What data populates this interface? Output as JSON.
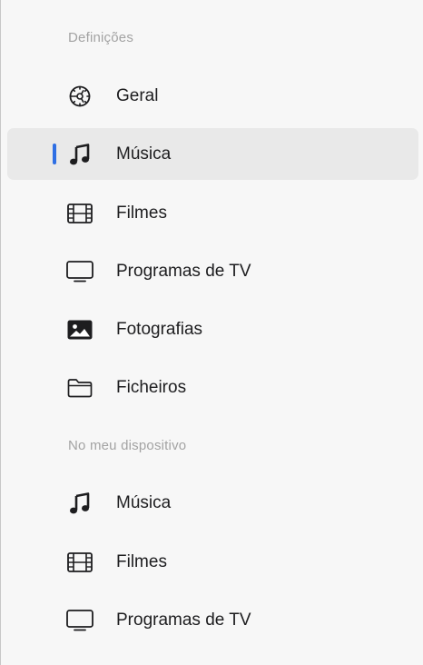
{
  "sections": [
    {
      "header": "Definições",
      "items": [
        {
          "label": "Geral",
          "icon": "gear-icon",
          "selected": false
        },
        {
          "label": "Música",
          "icon": "music-note-icon",
          "selected": true
        },
        {
          "label": "Filmes",
          "icon": "film-icon",
          "selected": false
        },
        {
          "label": "Programas de TV",
          "icon": "tv-icon",
          "selected": false
        },
        {
          "label": "Fotografias",
          "icon": "photo-icon",
          "selected": false
        },
        {
          "label": "Ficheiros",
          "icon": "folder-icon",
          "selected": false
        }
      ]
    },
    {
      "header": "No meu dispositivo",
      "items": [
        {
          "label": "Música",
          "icon": "music-note-icon",
          "selected": false
        },
        {
          "label": "Filmes",
          "icon": "film-icon",
          "selected": false
        },
        {
          "label": "Programas de TV",
          "icon": "tv-icon",
          "selected": false
        }
      ]
    }
  ],
  "colors": {
    "selection_background": "#e9e9e9",
    "selection_indicator": "#2f6fe4",
    "section_header_text": "#a3a3a3",
    "item_text": "#1d1d1f"
  }
}
